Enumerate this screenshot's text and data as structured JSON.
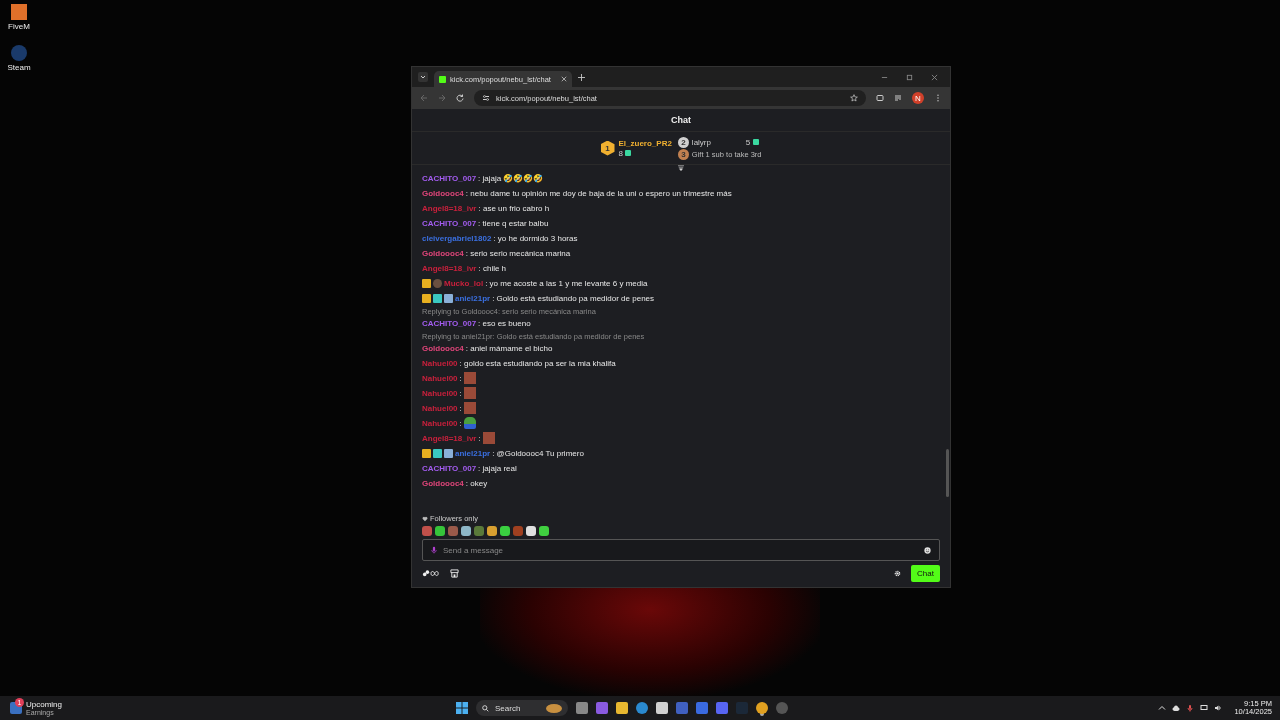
{
  "desktop_icons": [
    {
      "label": "FiveM",
      "kind": "fivem"
    },
    {
      "label": "Steam",
      "kind": "steam"
    }
  ],
  "browser": {
    "tab_title": "kick.com/popout/nebu_lst/chat",
    "url": "kick.com/popout/nebu_lst/chat",
    "profile_initial": "N"
  },
  "chat": {
    "title": "Chat",
    "leaderboard": [
      {
        "rank": "1",
        "name": "El_zuero_PR2",
        "count": "8"
      },
      {
        "rank": "2",
        "name": "lalyrp",
        "count": "5"
      },
      {
        "rank": "3",
        "name": "Gift 1 sub to take 3rd"
      }
    ],
    "messages": [
      {
        "user": "CACHITO_007",
        "color": "#a35cf0",
        "text": ": jajaja 🤣🤣🤣🤣"
      },
      {
        "user": "Goldoooc4",
        "color": "#e0457a",
        "text": ": nebu dame tu opinión me doy de baja de la uni o espero un trimestre más"
      },
      {
        "user": "Angel8=18_ivr",
        "color": "#c8203c",
        "text": ": ase un frio cabro h"
      },
      {
        "user": "CACHITO_007",
        "color": "#a35cf0",
        "text": ": tiene q estar balbu"
      },
      {
        "user": "cleivergabriel1802",
        "color": "#3a6fe0",
        "text": ": yo he dormido 3 horas"
      },
      {
        "user": "Goldoooc4",
        "color": "#e0457a",
        "text": ": serio serio mecánica marina"
      },
      {
        "user": "Angel8=18_ivr",
        "color": "#c8203c",
        "text": ": chile h"
      },
      {
        "user": "Mucko_lol",
        "color": "#c8203c",
        "text": ": yo me acoste a las 1 y me levante 6 y media",
        "badges": [
          {
            "kind": "crown"
          },
          {
            "kind": "avatar"
          }
        ]
      },
      {
        "user": "aniel21pr",
        "color": "#3a6fe0",
        "text": ": Goldo está estudiando pa medidor de penes",
        "badges": [
          {
            "kind": "crown"
          },
          {
            "kind": "sub"
          },
          {
            "kind": "gift"
          }
        ]
      },
      {
        "user": "CACHITO_007",
        "color": "#a35cf0",
        "text": ": eso es bueno",
        "reply": "Replying to Goldoooc4: serio serio mecánica marina"
      },
      {
        "user": "Goldoooc4",
        "color": "#e0457a",
        "text": ": aniel mámame el bicho",
        "reply": "Replying to aniel21pr: Goldo está estudiando pa medidor de penes"
      },
      {
        "user": "Nahuel00",
        "color": "#c8203c",
        "text": ": goldo esta estudiando pa ser la mia khalifa"
      },
      {
        "user": "Nahuel00",
        "color": "#c8203c",
        "text": ":",
        "emote": {
          "kind": "face"
        }
      },
      {
        "user": "Nahuel00",
        "color": "#c8203c",
        "text": ":",
        "emote": {
          "kind": "face"
        }
      },
      {
        "user": "Nahuel00",
        "color": "#c8203c",
        "text": ":",
        "emote": {
          "kind": "face"
        }
      },
      {
        "user": "Nahuel00",
        "color": "#c8203c",
        "text": ":",
        "emote": {
          "kind": "frog"
        }
      },
      {
        "user": "Angel8=18_ivr",
        "color": "#c8203c",
        "text": ":",
        "emote": {
          "kind": "face"
        }
      },
      {
        "user": "aniel21pr",
        "color": "#3a6fe0",
        "text": ": @Goldoooc4  Tu primero",
        "badges": [
          {
            "kind": "crown"
          },
          {
            "kind": "sub"
          },
          {
            "kind": "gift"
          }
        ]
      },
      {
        "user": "CACHITO_007",
        "color": "#a35cf0",
        "text": ": jajaja real"
      },
      {
        "user": "Goldoooc4",
        "color": "#e0457a",
        "text": ": okey"
      }
    ],
    "mode": "Followers only",
    "input": {
      "placeholder": "Send a message"
    },
    "send_label": "Chat"
  },
  "taskbar": {
    "widget_title": "Upcoming",
    "widget_subtitle": "Earnings",
    "widget_badge": "1",
    "search": "Search",
    "time": "9:15 PM",
    "date": "10/14/2025"
  }
}
